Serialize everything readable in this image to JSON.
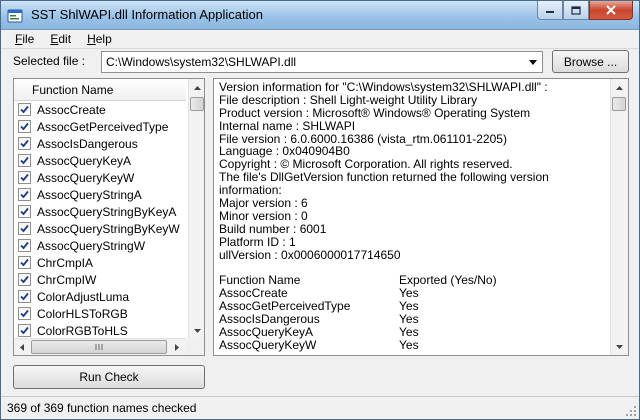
{
  "window": {
    "title": "SST ShlWAPI.dll Information Application",
    "icon": "app-icon",
    "controls": {
      "minimize": "minimize-icon",
      "maximize": "maximize-icon",
      "close": "close-icon"
    }
  },
  "menu": {
    "items": [
      {
        "label": "File",
        "accel": "F",
        "rest": "ile"
      },
      {
        "label": "Edit",
        "accel": "E",
        "rest": "dit"
      },
      {
        "label": "Help",
        "accel": "H",
        "rest": "elp"
      }
    ]
  },
  "file_selector": {
    "label": "Selected file :",
    "value": "C:\\Windows\\system32\\SHLWAPI.dll",
    "browse_label": "Browse ..."
  },
  "function_list": {
    "header": "Function Name",
    "items": [
      {
        "name": "AssocCreate",
        "checked": true
      },
      {
        "name": "AssocGetPerceivedType",
        "checked": true
      },
      {
        "name": "AssocIsDangerous",
        "checked": true
      },
      {
        "name": "AssocQueryKeyA",
        "checked": true
      },
      {
        "name": "AssocQueryKeyW",
        "checked": true
      },
      {
        "name": "AssocQueryStringA",
        "checked": true
      },
      {
        "name": "AssocQueryStringByKeyA",
        "checked": true
      },
      {
        "name": "AssocQueryStringByKeyW",
        "checked": true
      },
      {
        "name": "AssocQueryStringW",
        "checked": true
      },
      {
        "name": "ChrCmpIA",
        "checked": true
      },
      {
        "name": "ChrCmpIW",
        "checked": true
      },
      {
        "name": "ColorAdjustLuma",
        "checked": true
      },
      {
        "name": "ColorHLSToRGB",
        "checked": true
      },
      {
        "name": "ColorRGBToHLS",
        "checked": true
      }
    ]
  },
  "run_check_label": "Run Check",
  "info": {
    "lines": [
      "Version information for \"C:\\Windows\\system32\\SHLWAPI.dll\" :",
      "File description : Shell Light-weight Utility Library",
      "Product version : Microsoft® Windows® Operating System",
      "Internal name : SHLWAPI",
      "File version : 6.0.6000.16386 (vista_rtm.061101-2205)",
      "Language : 0x040904B0",
      "Copyright : © Microsoft Corporation. All rights reserved.",
      "The file's DllGetVersion function returned the following version",
      "information:",
      "Major version : 6",
      "Minor version : 0",
      "Build number : 6001",
      "Platform ID : 1",
      "ullVersion : 0x0006000017714650"
    ],
    "table_header": {
      "name": "Function Name",
      "exported": "Exported (Yes/No)"
    },
    "table_rows": [
      {
        "name": "AssocCreate",
        "exported": "Yes"
      },
      {
        "name": "AssocGetPerceivedType",
        "exported": "Yes"
      },
      {
        "name": "AssocIsDangerous",
        "exported": "Yes"
      },
      {
        "name": "AssocQueryKeyA",
        "exported": "Yes"
      },
      {
        "name": "AssocQueryKeyW",
        "exported": "Yes"
      }
    ]
  },
  "status": {
    "text": "369 of 369 function names checked"
  },
  "colors": {
    "check": "#1c3a8a",
    "titlebar": "#9cc3e8",
    "close": "#c8462e"
  }
}
